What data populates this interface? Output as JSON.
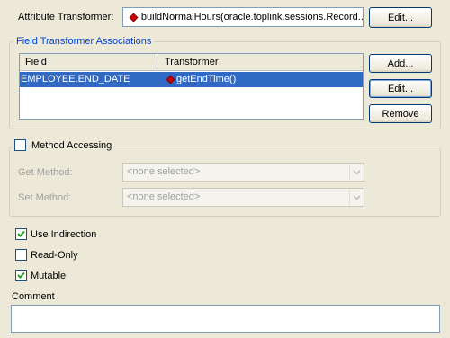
{
  "attribute_transformer": {
    "label": "Attribute Transformer:",
    "value": "buildNormalHours(oracle.toplink.sessions.Record...",
    "edit_label": "Edit..."
  },
  "field_associations": {
    "title": "Field Transformer Associations",
    "columns": [
      "Field",
      "Transformer"
    ],
    "rows": [
      {
        "field": "EMPLOYEE.END_DATE",
        "transformer": "getEndTime()"
      }
    ],
    "buttons": {
      "add": "Add...",
      "edit": "Edit...",
      "remove": "Remove"
    }
  },
  "method_accessing": {
    "label": "Method Accessing",
    "checked": false,
    "get_label": "Get Method:",
    "get_value": "<none selected>",
    "set_label": "Set Method:",
    "set_value": "<none selected>"
  },
  "options": {
    "use_indirection": {
      "label": "Use Indirection",
      "checked": true
    },
    "read_only": {
      "label": "Read-Only",
      "checked": false
    },
    "mutable": {
      "label": "Mutable",
      "checked": true
    }
  },
  "comment": {
    "label": "Comment",
    "value": ""
  },
  "colors": {
    "selection": "#316ac5",
    "group_title": "#0046d5",
    "background": "#ece9d8"
  }
}
